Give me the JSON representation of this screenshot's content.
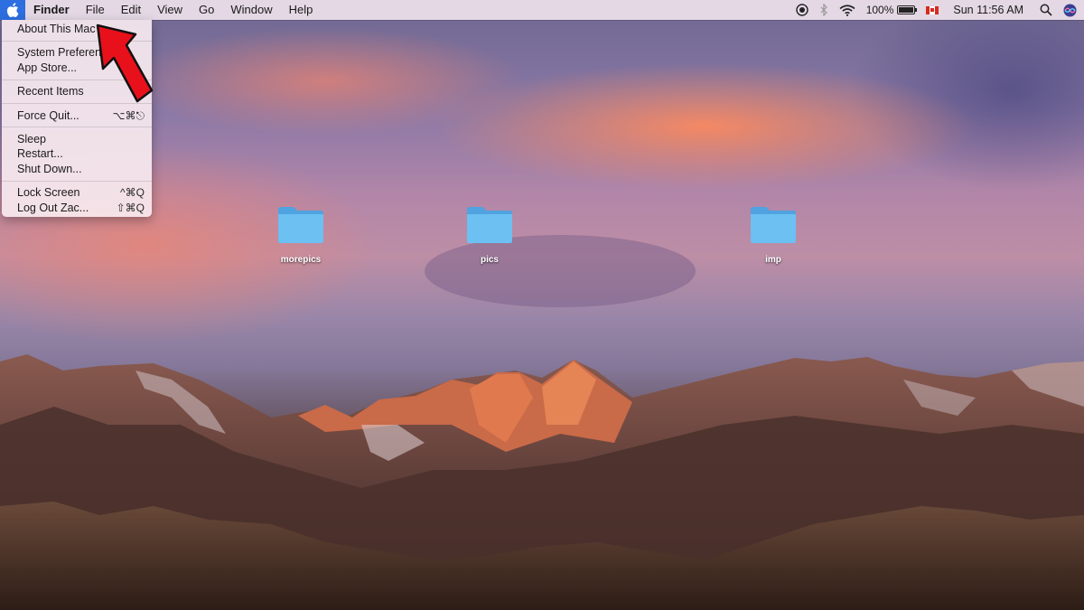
{
  "menubar": {
    "apple_icon": "apple-logo-icon",
    "items": [
      "Finder",
      "File",
      "Edit",
      "View",
      "Go",
      "Window",
      "Help"
    ],
    "status": {
      "battery_text": "100%",
      "battery_level": 1.0,
      "datetime": "Sun 11:56 AM",
      "icons": [
        "screen-record-icon",
        "bluetooth-icon",
        "wifi-icon",
        "battery-icon",
        "canada-flag-icon",
        "search-icon",
        "siri-icon"
      ]
    },
    "accent": "#2d6ee0"
  },
  "apple_menu": {
    "groups": [
      [
        {
          "label": "About This Mac",
          "shortcut": ""
        }
      ],
      [
        {
          "label": "System Preferen",
          "shortcut": ""
        },
        {
          "label": "App Store...",
          "shortcut": ""
        }
      ],
      [
        {
          "label": "Recent Items",
          "shortcut": ""
        }
      ],
      [
        {
          "label": "Force Quit...",
          "shortcut": "⌥⌘⎋"
        }
      ],
      [
        {
          "label": "Sleep",
          "shortcut": ""
        },
        {
          "label": "Restart...",
          "shortcut": ""
        },
        {
          "label": "Shut Down...",
          "shortcut": ""
        }
      ],
      [
        {
          "label": "Lock Screen",
          "shortcut": "^⌘Q"
        },
        {
          "label": "Log Out Zac...",
          "shortcut": "⇧⌘Q"
        }
      ]
    ]
  },
  "desktop": {
    "folders": [
      {
        "name": "morepics"
      },
      {
        "name": "pics"
      },
      {
        "name": "imp"
      }
    ],
    "folder_color": "#5ab4ec"
  },
  "annotation": {
    "arrow_color": "#e8101a"
  }
}
